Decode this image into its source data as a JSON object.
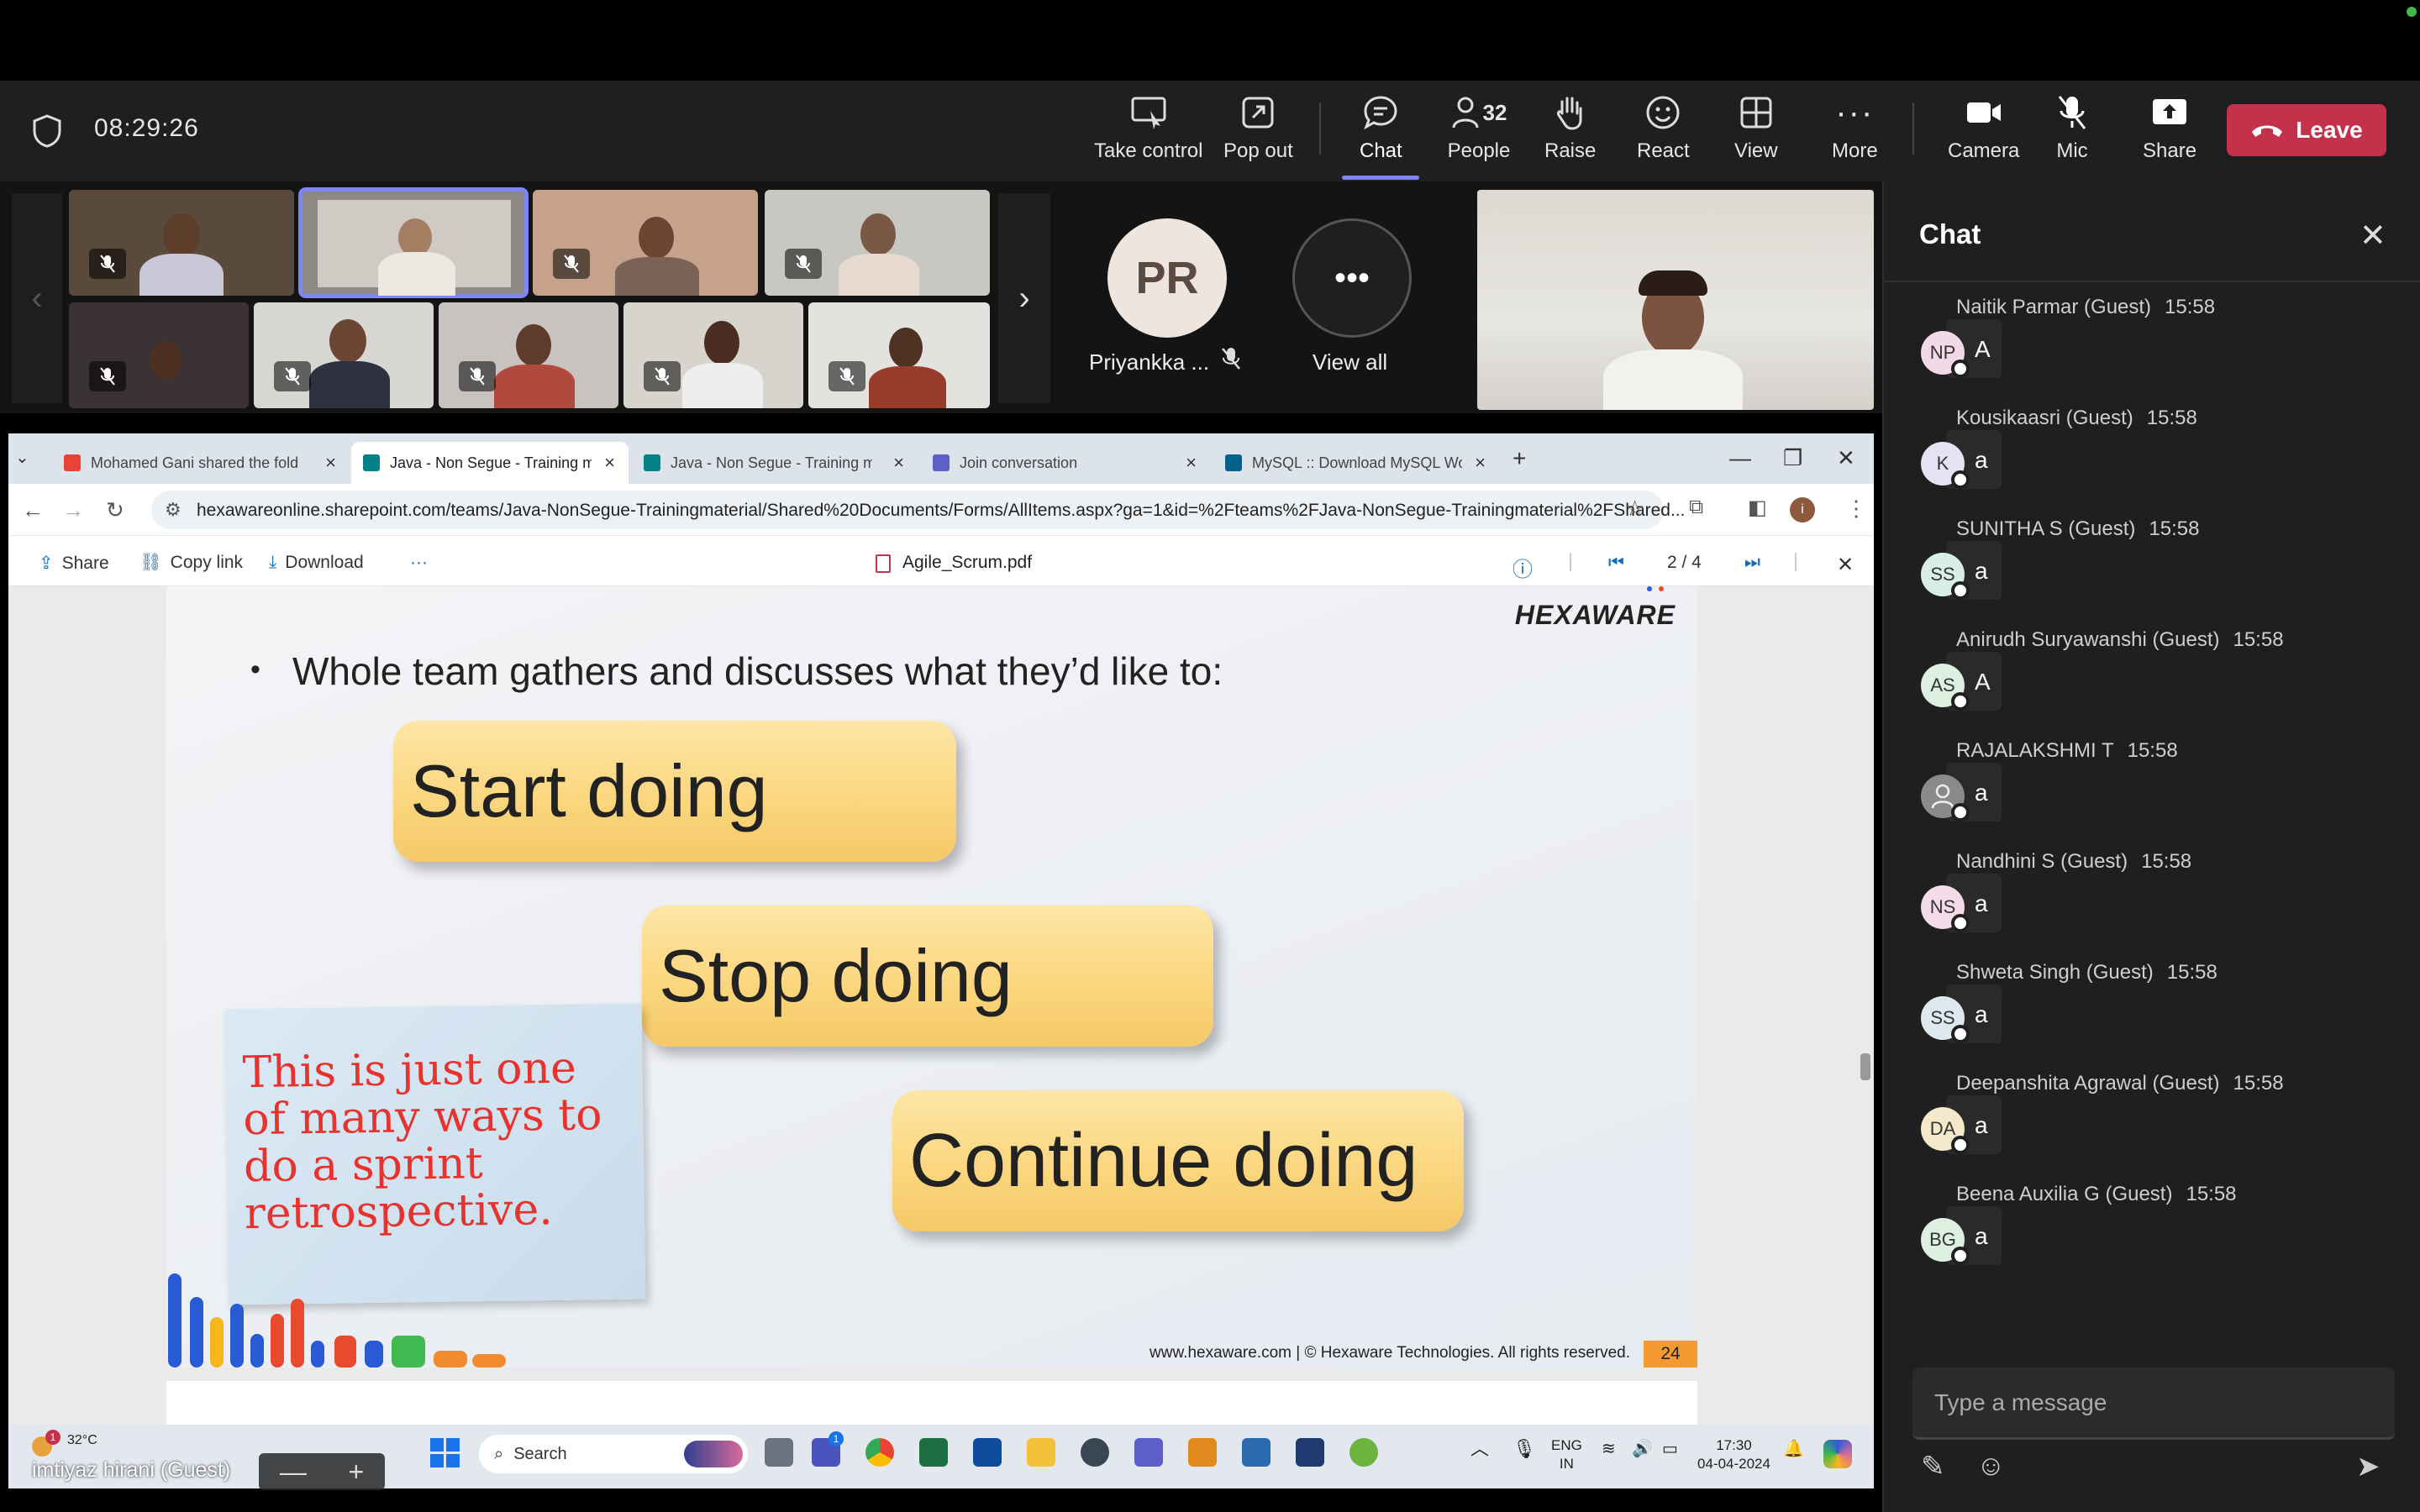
{
  "meeting": {
    "timer": "08:29:26",
    "toolbar": {
      "take_control": "Take control",
      "pop_out": "Pop out",
      "chat": "Chat",
      "people": "People",
      "people_count": "32",
      "raise": "Raise",
      "react": "React",
      "view": "View",
      "more": "More",
      "camera": "Camera",
      "mic": "Mic",
      "share": "Share",
      "leave": "Leave"
    },
    "participants": {
      "avatar_initials": "PR",
      "avatar_name": "Priyankka ...",
      "view_all": "View all"
    },
    "self_view": {
      "name": "imtiyaz hirani (Guest)",
      "zoom_minus": "—",
      "zoom_plus": "+"
    }
  },
  "browser": {
    "tabs": [
      {
        "title": "Mohamed Gani shared the fold",
        "favicon_color": "#ea4335"
      },
      {
        "title": "Java - Non Segue - Training ma",
        "favicon_color": "#038387"
      },
      {
        "title": "Java - Non Segue - Training ma",
        "favicon_color": "#038387"
      },
      {
        "title": "Join conversation",
        "favicon_color": "#5b5fc7"
      },
      {
        "title": "MySQL :: Download MySQL Wo",
        "favicon_color": "#00618a"
      }
    ],
    "new_tab": "+",
    "url": "hexawareonline.sharepoint.com/teams/Java-NonSegue-Trainingmaterial/Shared%20Documents/Forms/AllItems.aspx?ga=1&id=%2Fteams%2FJava-NonSegue-Trainingmaterial%2FShared...",
    "profile_initial": "i"
  },
  "pdf_viewer": {
    "share": "Share",
    "copy_link": "Copy link",
    "download": "Download",
    "more": "···",
    "filename": "Agile_Scrum.pdf",
    "page": "2 / 4"
  },
  "slide": {
    "logo": "HEXAWARE",
    "bullet": "Whole team gathers and discusses what they’d like to:",
    "stickers": [
      "Start doing",
      "Stop doing",
      "Continue doing"
    ],
    "note": "This is just one of many ways to do a sprint retrospective.",
    "footer": "www.hexaware.com  | © Hexaware Technologies. All rights reserved.",
    "page_number": "24"
  },
  "taskbar": {
    "weather_temp": "32°C",
    "weather_badge": "1",
    "search": "Search",
    "teams_badge": "1",
    "lang_top": "ENG",
    "lang_bottom": "IN",
    "time": "17:30",
    "date": "04-04-2024"
  },
  "chat": {
    "title": "Chat",
    "placeholder": "Type a message",
    "messages": [
      {
        "name": "Naitik Parmar (Guest)",
        "time": "15:58",
        "initials": "NP",
        "text": "A",
        "avatar_bg": "#f1d9e6"
      },
      {
        "name": "Kousikaasri (Guest)",
        "time": "15:58",
        "initials": "K",
        "text": "a",
        "avatar_bg": "#e7e2f3"
      },
      {
        "name": "SUNITHA S (Guest)",
        "time": "15:58",
        "initials": "SS",
        "text": "a",
        "avatar_bg": "#d9efe6"
      },
      {
        "name": "Anirudh Suryawanshi (Guest)",
        "time": "15:58",
        "initials": "AS",
        "text": "A",
        "avatar_bg": "#dcefe1"
      },
      {
        "name": "RAJALAKSHMI T",
        "time": "15:58",
        "initials": "",
        "text": "a",
        "avatar_bg": "#8a8a8a"
      },
      {
        "name": "Nandhini S (Guest)",
        "time": "15:58",
        "initials": "NS",
        "text": "a",
        "avatar_bg": "#f3dbe8"
      },
      {
        "name": "Shweta Singh (Guest)",
        "time": "15:58",
        "initials": "SS",
        "text": "a",
        "avatar_bg": "#dde9ef"
      },
      {
        "name": "Deepanshita Agrawal (Guest)",
        "time": "15:58",
        "initials": "DA",
        "text": "a",
        "avatar_bg": "#f3e8c9"
      },
      {
        "name": "Beena Auxilia G (Guest)",
        "time": "15:58",
        "initials": "BG",
        "text": "a",
        "avatar_bg": "#dcefe1"
      }
    ]
  },
  "colors": {
    "accent": "#7f85f5",
    "leave": "#c4314b",
    "note_text": "#e8322e"
  }
}
